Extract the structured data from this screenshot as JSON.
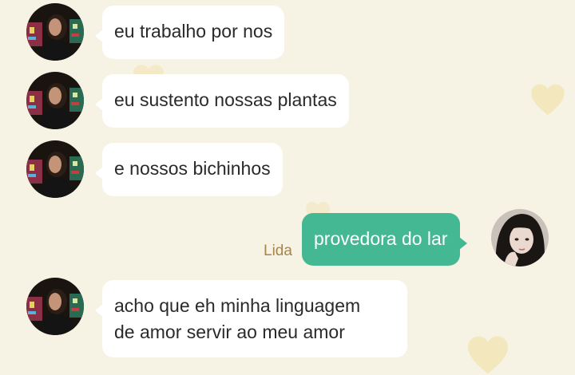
{
  "messages": [
    {
      "from": "other",
      "text": "eu trabalho por nos"
    },
    {
      "from": "other",
      "text": "eu sustento nossas plantas"
    },
    {
      "from": "other",
      "text": "e nossos bichinhos"
    },
    {
      "from": "me",
      "sender": "Lida",
      "text": "provedora do lar"
    },
    {
      "from": "other",
      "lines": [
        "acho que eh minha linguagem",
        "de amor servir ao meu amor"
      ]
    }
  ],
  "colors": {
    "background": "#f6f2e4",
    "incoming_bubble": "#ffffff",
    "outgoing_bubble": "#44b892",
    "sender_name": "#a8844a",
    "heart": "#f2dfa0"
  },
  "icons": {
    "background_decoration": "heart-icon"
  }
}
